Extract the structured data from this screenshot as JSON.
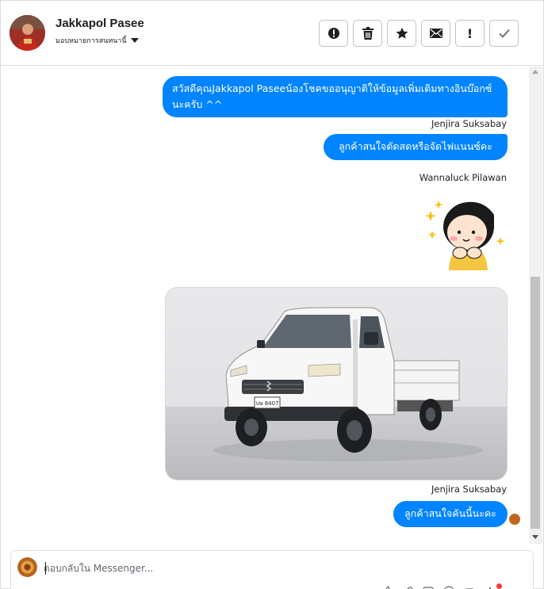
{
  "header": {
    "contact_name": "Jakkapol Pasee",
    "assign_label": "มอบหมายการสนทนานี้",
    "actions": [
      {
        "name": "spam-button",
        "icon": "alert-circle-icon"
      },
      {
        "name": "delete-button",
        "icon": "trash-icon"
      },
      {
        "name": "star-button",
        "icon": "star-icon"
      },
      {
        "name": "mark-unread-button",
        "icon": "envelope-icon"
      },
      {
        "name": "follow-up-button",
        "icon": "exclamation-icon",
        "glyph": "!"
      },
      {
        "name": "done-button",
        "icon": "check-icon"
      }
    ]
  },
  "messages": {
    "m1": "สวัสดีคุณJakkapol Paseeน้องโชคขออนุญาติให้ข้อมูลเพิ่มเติมทางอินบ๊อกซ์นะครับ ^^",
    "m1_sender": "Jenjira Suksabay",
    "m2": "ลูกค้าสนใจตัดสดหรือจัดไฟแนนซ์คะ",
    "m2_sender": "Wannaluck Pilawan",
    "m3_sender": "Jenjira Suksabay",
    "m3": "ลูกค้าสนใจคันนี้นะคะ",
    "plate_text": "บษ 8407"
  },
  "composer": {
    "placeholder": "ตอบกลับใน Messenger..."
  },
  "colors": {
    "bubble": "#0084ff",
    "border": "#dadde1"
  }
}
